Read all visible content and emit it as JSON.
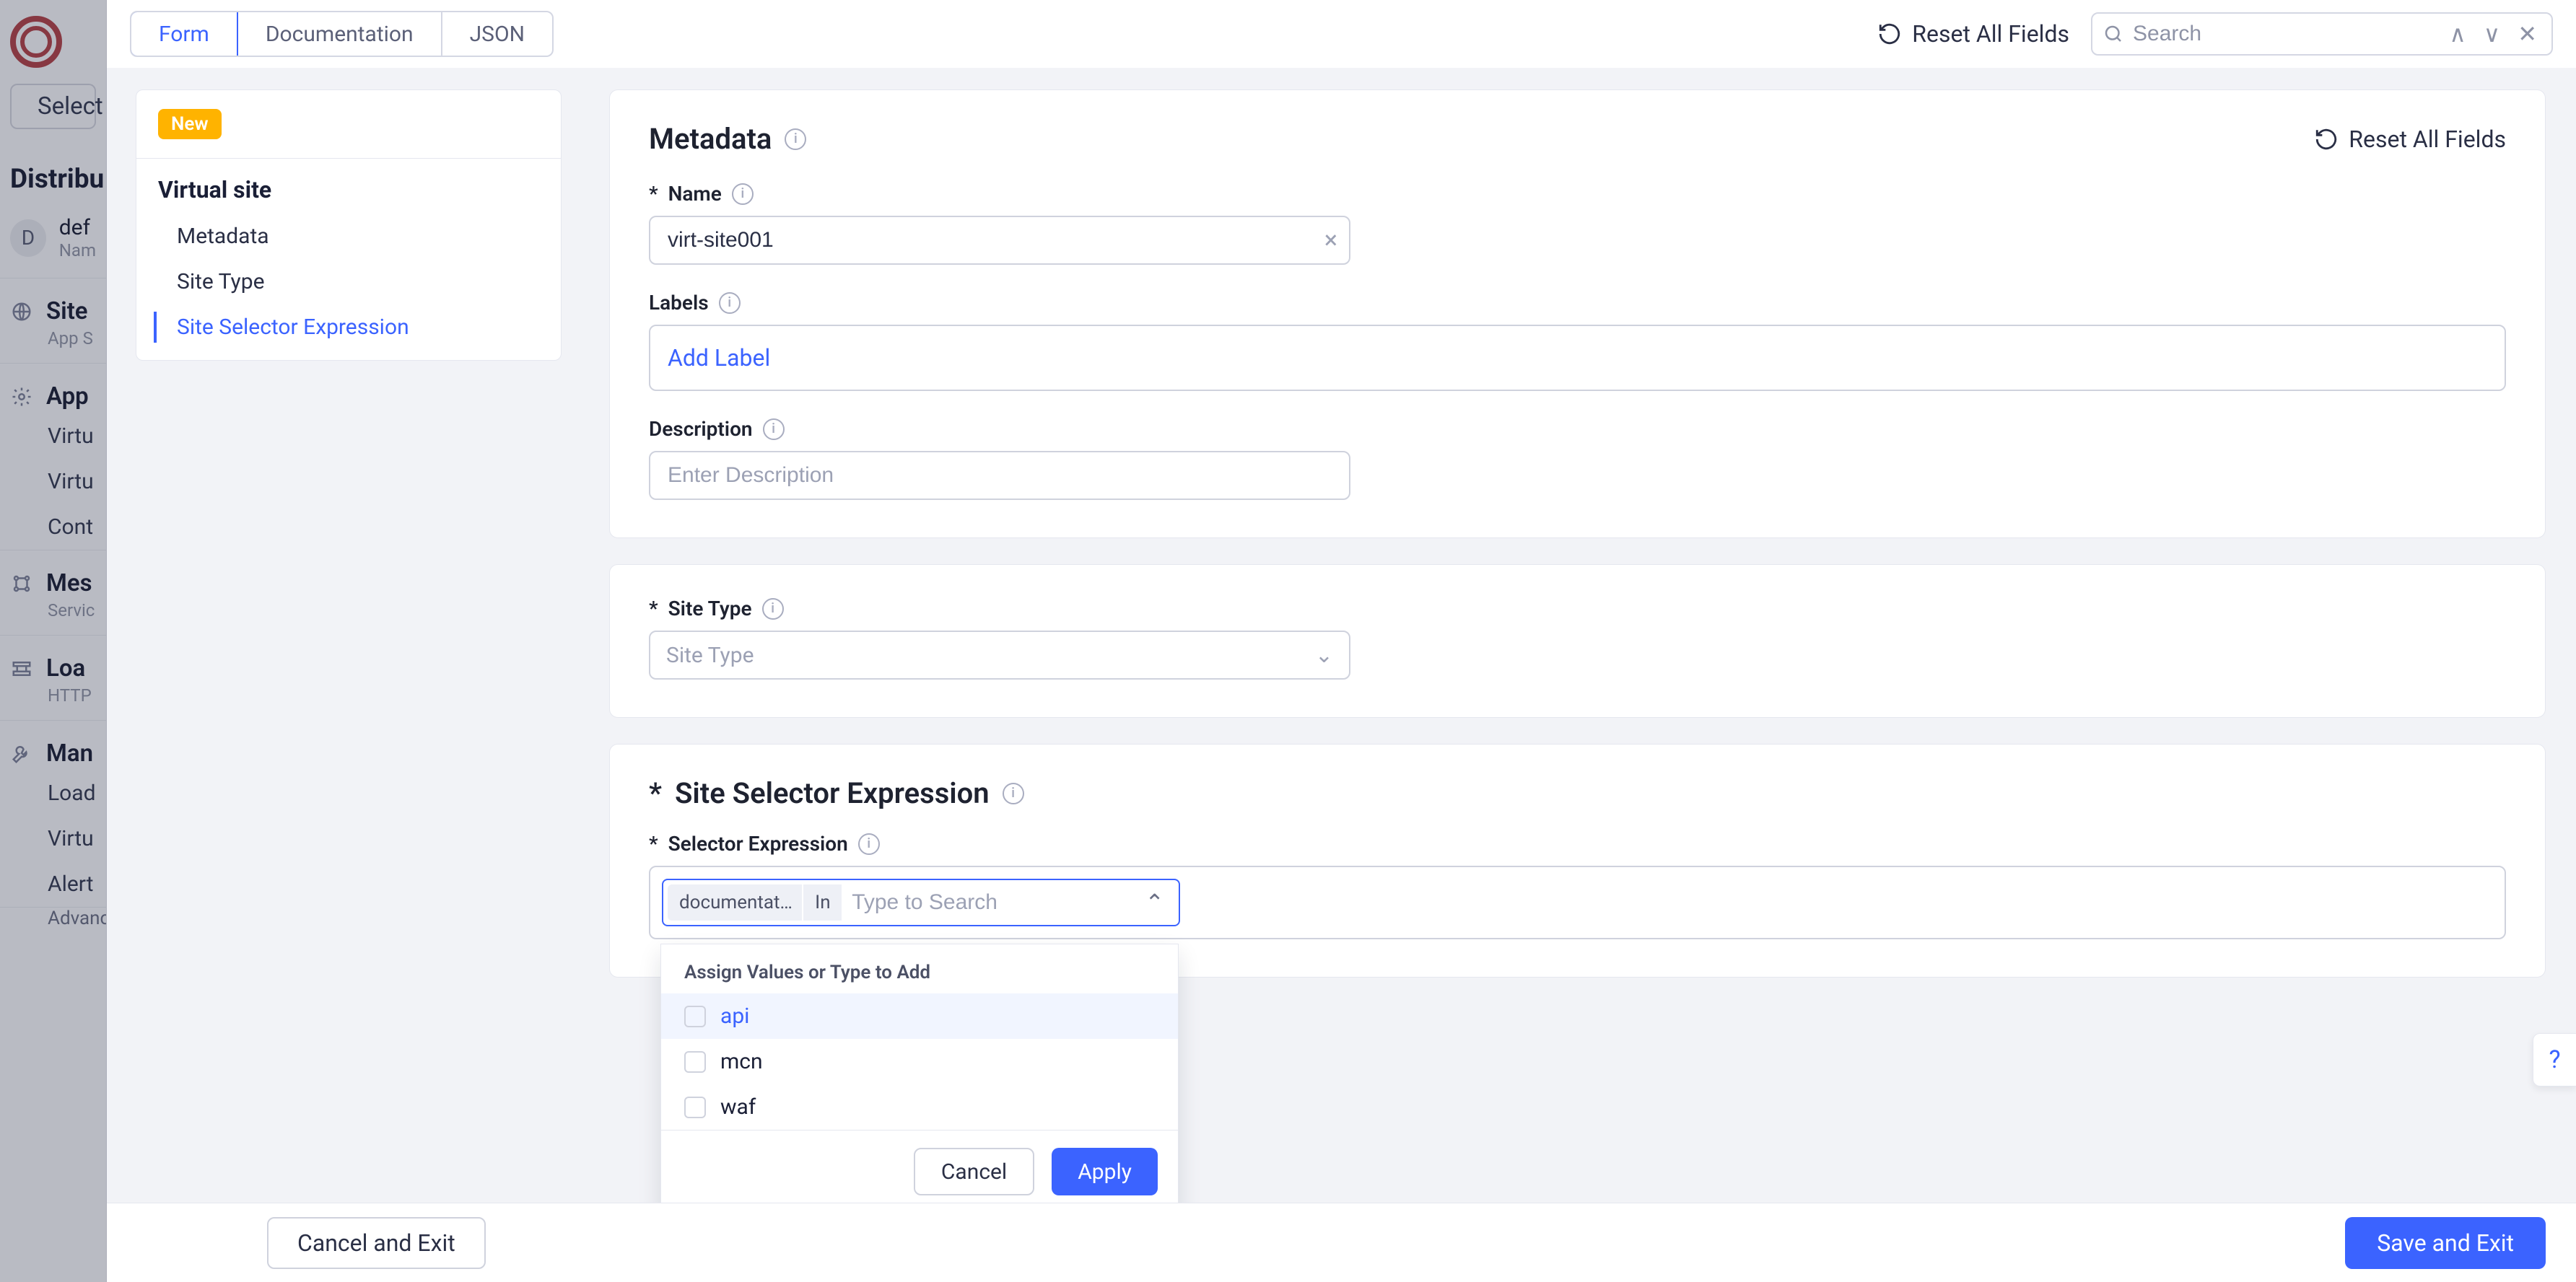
{
  "bg": {
    "select_service": "Select",
    "heading": "Distribu",
    "namespace": {
      "letter": "D",
      "name": "def",
      "sub": "Nam"
    },
    "sections": [
      {
        "title": "Site",
        "sub": "App S",
        "items": []
      },
      {
        "title": "App",
        "sub": "",
        "items": [
          "Virtu",
          "Virtu",
          "Cont"
        ]
      },
      {
        "title": "Mes",
        "sub": "Servic",
        "items": []
      },
      {
        "title": "Loa",
        "sub": "HTTP",
        "items": []
      },
      {
        "title": "Man",
        "sub": "",
        "items": [
          "Load",
          "Virtu",
          "Alert"
        ]
      }
    ],
    "advanced": "Advanced"
  },
  "topbar": {
    "tabs": [
      "Form",
      "Documentation",
      "JSON"
    ],
    "reset": "Reset All Fields",
    "search_placeholder": "Search"
  },
  "sidenav": {
    "new_badge": "New",
    "title": "Virtual site",
    "items": [
      "Metadata",
      "Site Type",
      "Site Selector Expression"
    ],
    "active": 2
  },
  "form": {
    "metadata": {
      "title": "Metadata",
      "reset": "Reset All Fields",
      "name_label": "Name",
      "name_value": "virt-site001",
      "labels_label": "Labels",
      "add_label": "Add Label",
      "description_label": "Description",
      "description_placeholder": "Enter Description"
    },
    "site_type": {
      "label": "Site Type",
      "placeholder": "Site Type"
    },
    "selector": {
      "title": "Site Selector Expression",
      "label": "Selector Expression",
      "chip1": "documentat…",
      "chip2": "In",
      "input_placeholder": "Type to Search",
      "dropdown": {
        "heading": "Assign Values or Type to Add",
        "options": [
          "api",
          "mcn",
          "waf"
        ],
        "cancel": "Cancel",
        "apply": "Apply"
      }
    }
  },
  "footer": {
    "cancel": "Cancel and Exit",
    "save": "Save and Exit"
  }
}
